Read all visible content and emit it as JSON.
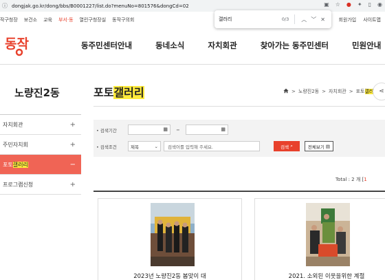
{
  "browser": {
    "url": "dongjak.go.kr/dong/bbs/B0001227/list.do?menuNo=801576&dongCd=02"
  },
  "find": {
    "query": "갤러리",
    "count": "0/3"
  },
  "top_links": [
    "작구청장",
    "보건소",
    "교육",
    "부서·동",
    "열린구청장실",
    "동작구의회"
  ],
  "top_right_links": [
    "회원가입",
    "사이트맵"
  ],
  "logo_text": "동작",
  "main_menu": [
    "동주민센터안내",
    "동네소식",
    "자치회관",
    "찾아가는 동주민센터",
    "민원안내"
  ],
  "sidebar": {
    "title": "노량진2동",
    "items": [
      {
        "label": "자치회관",
        "icon": "+"
      },
      {
        "label": "주민자치회",
        "icon": "+"
      },
      {
        "label_pre": "포토",
        "label_hl": "갤러리",
        "icon": "−"
      },
      {
        "label": "프로그램신청",
        "icon": "+"
      }
    ]
  },
  "content": {
    "title_pre": "포토",
    "title_hl": "갤러리",
    "breadcrumb": {
      "b1": "노량진2동",
      "b2": "자치회관",
      "b3_pre": "포토",
      "b3_hl": "갤러리"
    }
  },
  "search": {
    "period_label": "• 검색기간",
    "condition_label": "• 검색조건",
    "select_value": "제목",
    "keyword_placeholder": "검색어를 입력해 주세요.",
    "search_button": "검색",
    "all_button": "전체보기"
  },
  "total": {
    "pre": "Total : 2 개 [",
    "page": "1"
  },
  "cards": [
    {
      "title": "2023년 노량진2동 봄맞이 대"
    },
    {
      "title": "2021. 소외된 이웃을위한 계절"
    }
  ],
  "colors": {
    "accent": "#e8412c",
    "sidebar_active": "#f06455",
    "highlight": "#ffeb3b"
  }
}
